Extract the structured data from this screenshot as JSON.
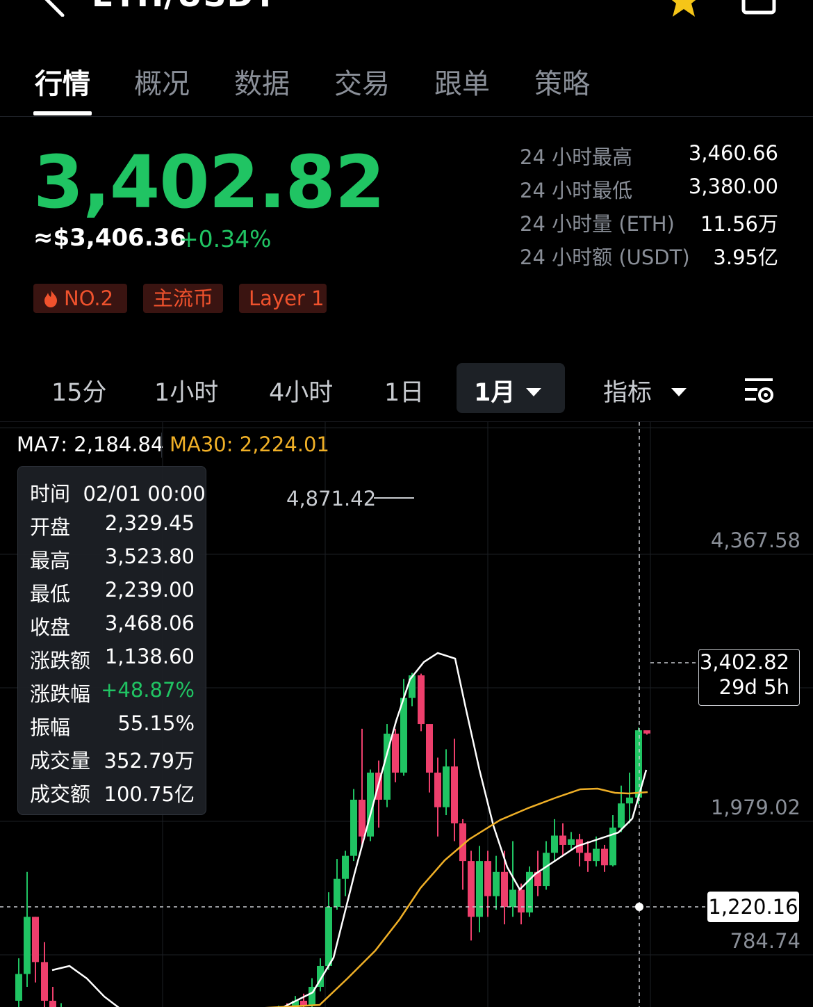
{
  "header": {
    "pair": "ETH/USDT",
    "icons": [
      "back-icon",
      "chevron-down-icon",
      "star-icon",
      "share-icon"
    ]
  },
  "tabs": [
    {
      "label": "行情",
      "active": true
    },
    {
      "label": "概况"
    },
    {
      "label": "数据"
    },
    {
      "label": "交易"
    },
    {
      "label": "跟单"
    },
    {
      "label": "策略"
    }
  ],
  "price": {
    "last": "3,402.82",
    "usd": "≈$3,406.36",
    "change": "+0.34%",
    "color_up": "#20c463"
  },
  "tags": [
    {
      "label": "NO.2",
      "icon": "fire-icon"
    },
    {
      "label": "主流币"
    },
    {
      "label": "Layer 1"
    }
  ],
  "stats": [
    {
      "label": "24 小时最高",
      "value": "3,460.66"
    },
    {
      "label": "24 小时最低",
      "value": "3,380.00"
    },
    {
      "label": "24 小时量 (ETH)",
      "value": "11.56万"
    },
    {
      "label": "24 小时额 (USDT)",
      "value": "3.95亿"
    }
  ],
  "intervals": [
    "15分",
    "1小时",
    "4小时",
    "1日",
    "1月",
    "指标"
  ],
  "selected_interval": "1月",
  "ma": {
    "ma7": "MA7: 2,184.84",
    "ma30": "MA30: 2,224.01",
    "ma7_color": "#ffffff",
    "ma30_color": "#f0b027"
  },
  "tooltip": {
    "time_label": "时间",
    "time_value": "02/01 00:00",
    "rows": [
      {
        "k": "开盘",
        "v": "2,329.45"
      },
      {
        "k": "最高",
        "v": "3,523.80"
      },
      {
        "k": "最低",
        "v": "2,239.00"
      },
      {
        "k": "收盘",
        "v": "3,468.06"
      },
      {
        "k": "涨跌额",
        "v": "1,138.60"
      },
      {
        "k": "涨跌幅",
        "v": "+48.87%"
      },
      {
        "k": "振幅",
        "v": "55.15%"
      },
      {
        "k": "成交量",
        "v": "352.79万"
      },
      {
        "k": "成交额",
        "v": "100.75亿"
      }
    ]
  },
  "chart_data": {
    "type": "candlestick",
    "interval": "1月",
    "y_ticks": [
      "4,367.58",
      "1,979.02",
      "784.74"
    ],
    "peak_label": "4,871.42",
    "last_price_label": "3,402.82",
    "countdown": "29d 5h",
    "cursor_price": "1,220.16",
    "colors": {
      "up": "#20c463",
      "down": "#ee3f6c"
    },
    "candles": [
      {
        "o": 800,
        "c": 1000,
        "h": 1050,
        "l": 700
      },
      {
        "o": 1000,
        "c": 1450,
        "h": 1620,
        "l": 950
      },
      {
        "o": 1450,
        "c": 1250,
        "h": 1550,
        "l": 1100
      },
      {
        "o": 1250,
        "c": 900,
        "h": 1300,
        "l": 800
      },
      {
        "o": 900,
        "c": 1000,
        "h": 1200,
        "l": 850
      },
      {
        "o": 1000,
        "c": 1100,
        "h": 1250,
        "l": 950
      },
      {
        "o": 1100,
        "c": 800,
        "h": 1150,
        "l": 700
      },
      {
        "o": 800,
        "c": 1000,
        "h": 1050,
        "l": 750
      },
      {
        "o": 1000,
        "c": 950,
        "h": 1100,
        "l": 900
      },
      {
        "o": 950,
        "c": 750,
        "h": 1000,
        "l": 650
      },
      {
        "o": 750,
        "c": 700,
        "h": 800,
        "l": 600
      },
      {
        "o": 700,
        "c": 750,
        "h": 800,
        "l": 650
      }
    ]
  },
  "chart_candles_visible": [
    {
      "o": 1150,
      "c": 1400,
      "h": 1600,
      "l": 900
    },
    {
      "o": 1400,
      "c": 1600,
      "h": 1750,
      "l": 1300
    },
    {
      "o": 1600,
      "c": 1300,
      "h": 1650,
      "l": 1100
    }
  ]
}
